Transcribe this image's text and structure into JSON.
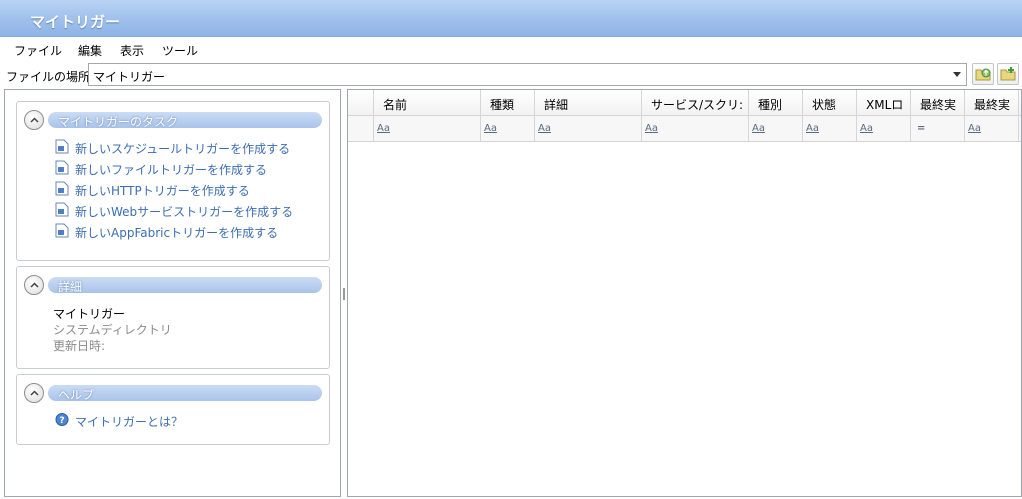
{
  "window": {
    "title": "マイトリガー"
  },
  "menu": [
    "ファイル",
    "編集",
    "表示",
    "ツール"
  ],
  "location": {
    "label": "ファイルの場所",
    "value": "マイトリガー"
  },
  "tasks": {
    "header": "マイトリガーのタスク",
    "items": [
      "新しいスケジュールトリガーを作成する",
      "新しいファイルトリガーを作成する",
      "新しいHTTPトリガーを作成する",
      "新しいWebサービストリガーを作成する",
      "新しいAppFabricトリガーを作成する"
    ]
  },
  "details": {
    "header": "詳細",
    "name": "マイトリガー",
    "type": "システムディレクトリ",
    "updated_label": "更新日時:"
  },
  "help": {
    "header": "ヘルプ",
    "link": "マイトリガーとは？"
  },
  "grid": {
    "columns": [
      "",
      "名前",
      "種類",
      "詳細",
      "サービス/スクリ:",
      "種別",
      "状態",
      "XMLロ",
      "最終実",
      "最終実"
    ],
    "filters": [
      "",
      "Aa",
      "Aa",
      "Aa",
      "Aa",
      "Aa",
      "Aa",
      "Aa",
      "=",
      "Aa"
    ]
  },
  "colors": {
    "link": "#3c6eb4",
    "header_bar": "#a9c4ea",
    "titlebar": "#9fc0ec"
  }
}
